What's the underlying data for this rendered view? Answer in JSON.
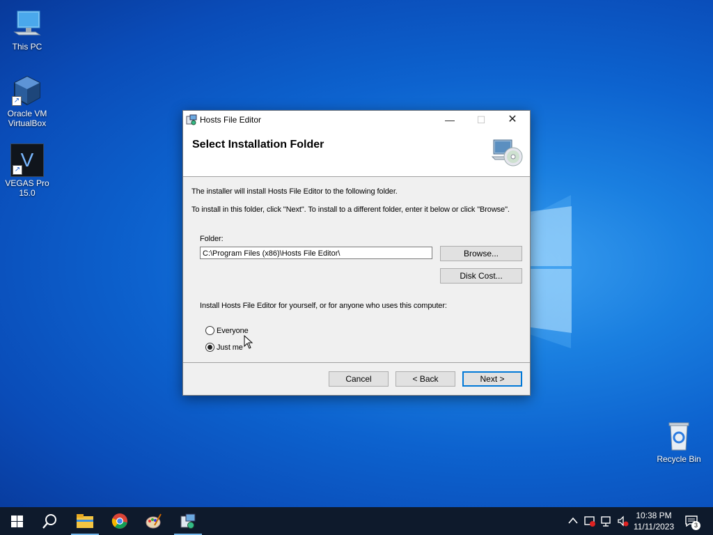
{
  "desktop": {
    "icons": [
      {
        "label_line1": "This PC",
        "label_line2": ""
      },
      {
        "label_line1": "Oracle VM",
        "label_line2": "VirtualBox"
      },
      {
        "label_line1": "VEGAS Pro",
        "label_line2": "15.0"
      },
      {
        "label_line1": "Recycle Bin",
        "label_line2": ""
      }
    ],
    "vegas_glyph": "V"
  },
  "window": {
    "title": "Hosts File Editor",
    "heading": "Select Installation Folder",
    "intro": "The installer will install Hosts File Editor to the following folder.",
    "instructions": "To install in this folder, click \"Next\". To install to a different folder, enter it below or click \"Browse\".",
    "folder_label": "Folder:",
    "folder_value": "C:\\Program Files (x86)\\Hosts File Editor\\",
    "browse_label": "Browse...",
    "disk_cost_label": "Disk Cost...",
    "scope_prompt": "Install Hosts File Editor for yourself, or for anyone who uses this computer:",
    "options": [
      {
        "label": "Everyone",
        "selected": false
      },
      {
        "label": "Just me",
        "selected": true
      }
    ],
    "cancel_label": "Cancel",
    "back_label": "< Back",
    "next_label": "Next >",
    "min_glyph": "—",
    "max_glyph": "☐",
    "close_glyph": "✕"
  },
  "taskbar": {
    "time": "10:38 PM",
    "date": "11/11/2023",
    "notification_count": "3",
    "pinned": [
      "start-icon",
      "search-icon",
      "file-explorer-icon",
      "chrome-icon",
      "paint-icon",
      "installer-icon"
    ]
  },
  "colors": {
    "accent": "#0078d7",
    "taskbar": "#0e1a2c",
    "desktop": "#0d63cf"
  }
}
